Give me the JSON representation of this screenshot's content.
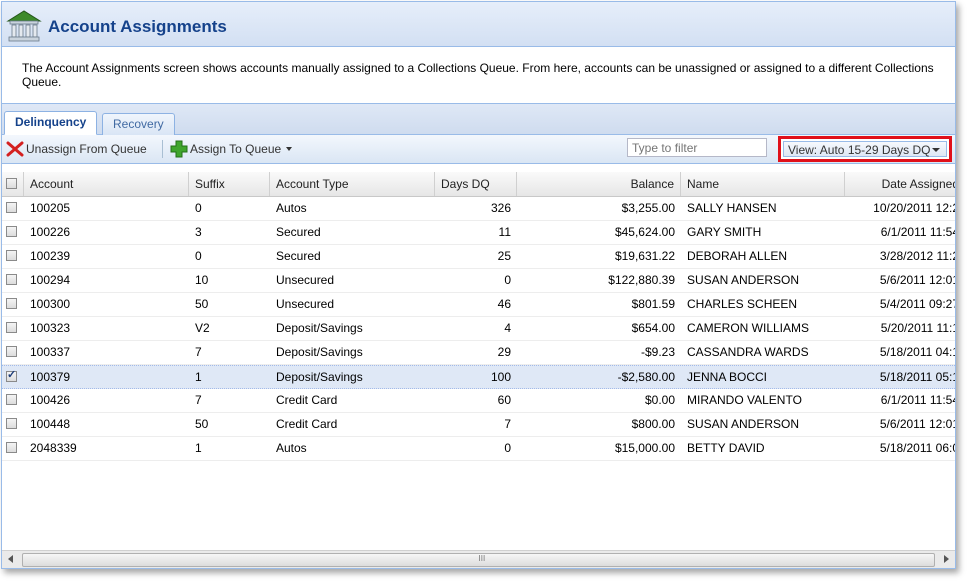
{
  "header": {
    "title": "Account Assignments",
    "icon": "bank-icon"
  },
  "description": "The Account Assignments screen shows accounts manually assigned to a Collections Queue. From here, accounts can be unassigned or assigned to a different Collections Queue.",
  "tabs": [
    {
      "label": "Delinquency",
      "active": true
    },
    {
      "label": "Recovery",
      "active": false
    }
  ],
  "toolbar": {
    "unassign_label": "Unassign From Queue",
    "assign_label": "Assign To Queue",
    "filter_placeholder": "Type to filter",
    "view_label": "View: Auto 15-29 Days DQ"
  },
  "grid": {
    "columns": [
      "Account",
      "Suffix",
      "Account Type",
      "Days DQ",
      "Balance",
      "Name",
      "Date Assigned"
    ],
    "rows": [
      {
        "checked": false,
        "account": "100205",
        "suffix": "0",
        "type": "Autos",
        "days": "326",
        "balance": "$3,255.00",
        "name": "SALLY HANSEN",
        "date": "10/20/2011 12:2"
      },
      {
        "checked": false,
        "account": "100226",
        "suffix": "3",
        "type": "Secured",
        "days": "11",
        "balance": "$45,624.00",
        "name": "GARY SMITH",
        "date": "6/1/2011 11:54"
      },
      {
        "checked": false,
        "account": "100239",
        "suffix": "0",
        "type": "Secured",
        "days": "25",
        "balance": "$19,631.22",
        "name": "DEBORAH ALLEN",
        "date": "3/28/2012 11:2"
      },
      {
        "checked": false,
        "account": "100294",
        "suffix": "10",
        "type": "Unsecured",
        "days": "0",
        "balance": "$122,880.39",
        "name": "SUSAN ANDERSON",
        "date": "5/6/2011 12:01"
      },
      {
        "checked": false,
        "account": "100300",
        "suffix": "50",
        "type": "Unsecured",
        "days": "46",
        "balance": "$801.59",
        "name": "CHARLES SCHEEN",
        "date": "5/4/2011 09:27"
      },
      {
        "checked": false,
        "account": "100323",
        "suffix": "V2",
        "type": "Deposit/Savings",
        "days": "4",
        "balance": "$654.00",
        "name": "CAMERON WILLIAMS",
        "date": "5/20/2011 11:1"
      },
      {
        "checked": false,
        "account": "100337",
        "suffix": "7",
        "type": "Deposit/Savings",
        "days": "29",
        "balance": "-$9.23",
        "name": "CASSANDRA WARDS",
        "date": "5/18/2011 04:1"
      },
      {
        "checked": true,
        "account": "100379",
        "suffix": "1",
        "type": "Deposit/Savings",
        "days": "100",
        "balance": "-$2,580.00",
        "name": "JENNA BOCCI",
        "date": "5/18/2011 05:1"
      },
      {
        "checked": false,
        "account": "100426",
        "suffix": "7",
        "type": "Credit Card",
        "days": "60",
        "balance": "$0.00",
        "name": "MIRANDO VALENTO",
        "date": "6/1/2011 11:54"
      },
      {
        "checked": false,
        "account": "100448",
        "suffix": "50",
        "type": "Credit Card",
        "days": "7",
        "balance": "$800.00",
        "name": "SUSAN ANDERSON",
        "date": "5/6/2011 12:01"
      },
      {
        "checked": false,
        "account": "2048339",
        "suffix": "1",
        "type": "Autos",
        "days": "0",
        "balance": "$15,000.00",
        "name": "BETTY DAVID",
        "date": "5/18/2011 06:0"
      }
    ]
  },
  "scrollbar": {
    "grip": "III"
  }
}
